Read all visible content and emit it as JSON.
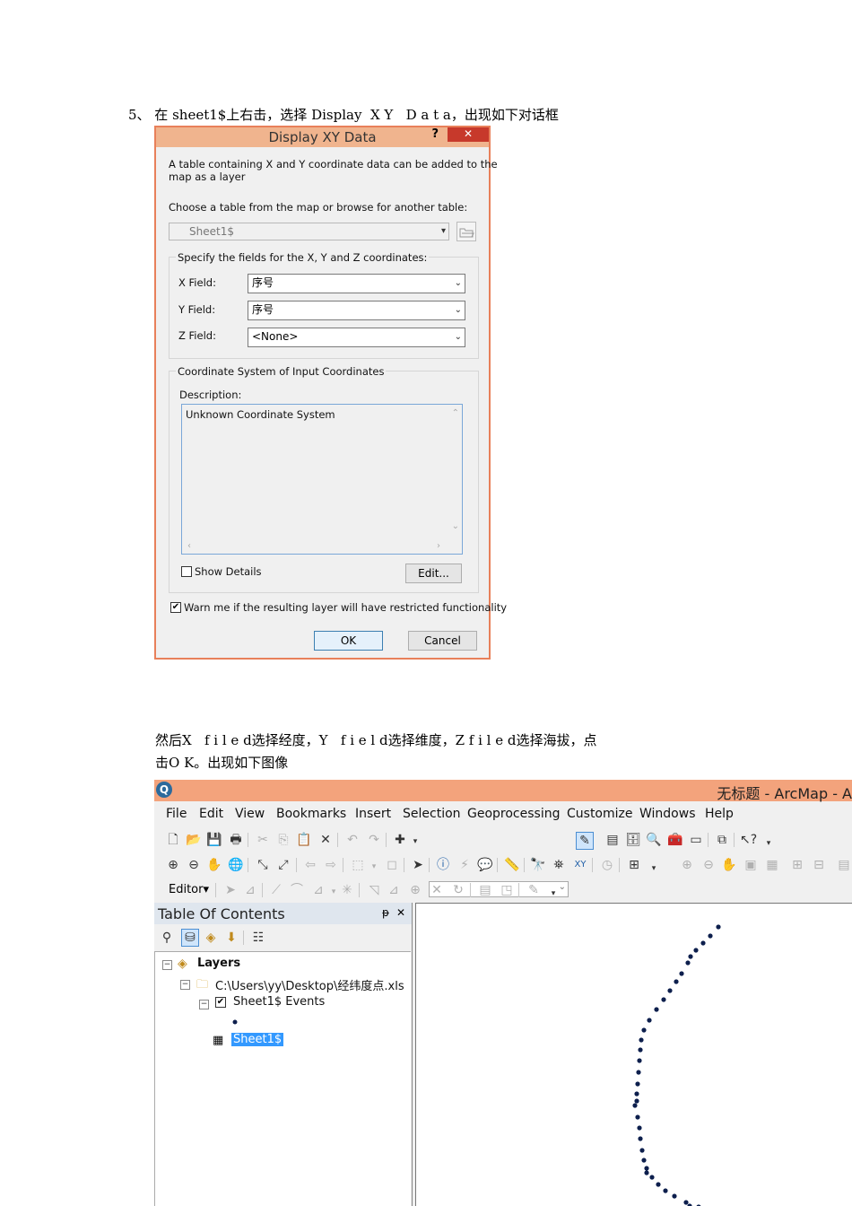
{
  "step_text": "5、 在 sheet1$上右击，选择 Display  X Y   D a t a，出现如下对话框",
  "dialog": {
    "title": "Display XY Data",
    "help_label": "?",
    "close_label": "✕",
    "intro": "A table containing X and Y coordinate data can be added to the\nmap as a layer",
    "choose_label": "Choose a table from the map or browse for another table:",
    "table_value": "Sheet1$",
    "fields_group_label": "Specify the fields for the X, Y and Z coordinates:",
    "x_label": "X Field:",
    "x_value": "序号",
    "y_label": "Y Field:",
    "y_value": "序号",
    "z_label": "Z Field:",
    "z_value": "<None>",
    "coord_group_label": "Coordinate System of Input Coordinates",
    "description_label": "Description:",
    "description_value": "Unknown Coordinate System",
    "show_details_label": "Show Details",
    "show_details_checked": false,
    "edit_label": "Edit...",
    "warn_label": "Warn me if the resulting layer will have restricted functionality",
    "warn_checked": true,
    "ok_label": "OK",
    "cancel_label": "Cancel"
  },
  "para_line1": "然后X   f i l e d选择经度，Y   f i e l d选择维度，Z f i l e d选择海拔，点",
  "para_line2": "击O K。出现如下图像",
  "arcmap": {
    "title": "无标题 - ArcMap - A",
    "menu": [
      "File",
      "Edit",
      "View",
      "Bookmarks",
      "Insert",
      "Selection",
      "Geoprocessing",
      "Customize",
      "Windows",
      "Help"
    ],
    "editor_label": "Editor▾",
    "toc_title": "Table Of Contents",
    "toc_pin": "ᵽ",
    "toc_close": "✕",
    "tree": {
      "layers": "Layers",
      "folder": "C:\\Users\\yy\\Desktop\\经纬度点.xls",
      "events": "Sheet1$ Events",
      "table": "Sheet1$"
    },
    "point_color": "#0d1f4d"
  }
}
